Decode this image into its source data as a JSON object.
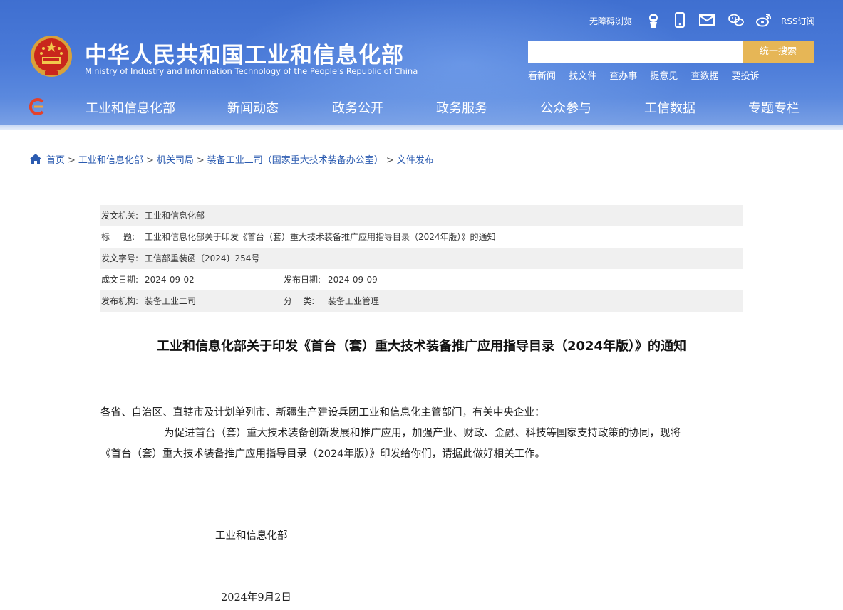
{
  "header": {
    "title_cn": "中华人民共和国工业和信息化部",
    "title_en": "Ministry of Industry and Information Technology of the People's Republic of China",
    "accessibility": "无障碍浏览",
    "rss": "RSS订阅",
    "icons": [
      "robot-icon",
      "mobile-icon",
      "mail-icon",
      "wechat-icon",
      "weibo-icon"
    ],
    "search": {
      "placeholder": "",
      "button": "统一搜索"
    },
    "quick_links": [
      "看新闻",
      "找文件",
      "查办事",
      "提意见",
      "查数据",
      "要投诉"
    ]
  },
  "nav": {
    "items": [
      "工业和信息化部",
      "新闻动态",
      "政务公开",
      "政务服务",
      "公众参与",
      "工信数据",
      "专题专栏"
    ]
  },
  "breadcrumb": [
    "首页",
    "工业和信息化部",
    "机关司局",
    "装备工业二司（国家重大技术装备办公室）",
    "文件发布"
  ],
  "info": {
    "issuer_label": "发文机关:",
    "issuer": "工业和信息化部",
    "title_label": "标     题:",
    "title": "工业和信息化部关于印发《首台（套）重大技术装备推广应用指导目录（2024年版）》的通知",
    "doc_no_label": "发文字号:",
    "doc_no": "工信部重装函〔2024〕254号",
    "written_label": "成文日期:",
    "written": "2024-09-02",
    "published_label": "发布日期:",
    "published": "2024-09-09",
    "agency_label": "发布机构:",
    "agency": "装备工业二司",
    "category_label": "分    类:",
    "category": "装备工业管理"
  },
  "article": {
    "title": "工业和信息化部关于印发《首台（套）重大技术装备推广应用指导目录（2024年版）》的通知",
    "salutation": "各省、自治区、直辖市及计划单列市、新疆生产建设兵团工业和信息化主管部门，有关中央企业：",
    "body_line1": "为促进首台（套）重大技术装备创新发展和推广应用，加强产业、财政、金融、科技等国家支持政策的协同，现将",
    "body_line2": "《首台（套）重大技术装备推广应用指导目录（2024年版）》印发给你们，请据此做好相关工作。",
    "signature_org": "工业和信息化部",
    "signature_date": "2024年9月2日"
  },
  "colors": {
    "header_blue": "#4a7ad8",
    "search_button": "#e6b656",
    "link_blue": "#2b5bb0"
  }
}
